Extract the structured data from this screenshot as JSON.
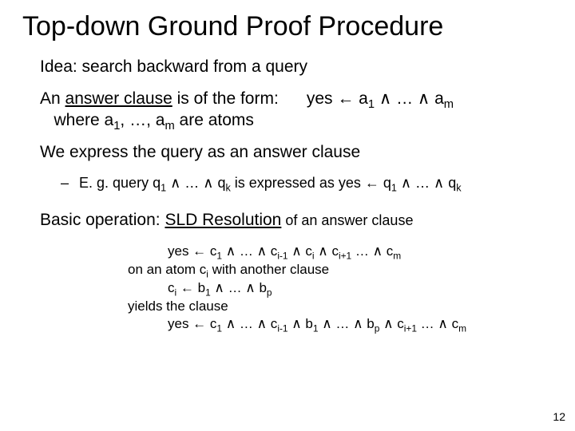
{
  "title": "Top-down Ground Proof Procedure",
  "p_idea": "Idea: search backward from a query",
  "p_answer_clause_1a": "An ",
  "p_answer_clause_1b_u": "answer clause",
  "p_answer_clause_1c": " is of the form:",
  "p_answer_formula": "yes ← a",
  "p_answer_formula_sub1": "1",
  "p_answer_formula_mid": " ∧ … ∧ a",
  "p_answer_formula_subm": "m",
  "p_answer_clause_2a": "where a",
  "p_answer_clause_2b": ", …, a",
  "p_answer_clause_2c": " are atoms",
  "p_express": "We express the query as an answer clause",
  "sub_dash": "–",
  "sub_eg_a": "E. g. query  q",
  "sub_eg_mid": " ∧ … ∧ q",
  "sub_eg_sub_k": "k",
  "sub_eg_b": "  is expressed as   yes ← q",
  "sub_eg_mid2": " ∧ … ∧ q",
  "p_basic_a": "Basic operation: ",
  "p_basic_u": "SLD Resolution",
  "p_basic_b": " of an answer clause",
  "sld_r1a": "yes ← c",
  "sld_r1_mid": " ∧ … ∧ c",
  "sld_r1_im1": "i-1",
  "sld_r1_and_ci": " ∧ c",
  "sld_r1_i": "i",
  "sld_r1_and_cip1": " ∧ c",
  "sld_r1_ip1": "i+1",
  "sld_r1_tail": " … ∧ c",
  "sld_r1_m": "m",
  "sld_r2a": "on an atom c",
  "sld_r2b": " with another clause",
  "sld_r3a": "c",
  "sld_r3b": " ← b",
  "sld_r3_mid": " ∧ … ∧ b",
  "sld_r3_p": "p",
  "sld_r4": "yields the clause",
  "sld_r5a": "yes ← c",
  "sld_r5_mid1": " ∧ … ∧ c",
  "sld_r5_and_b1": " ∧ b",
  "sld_r5_mid2": " ∧ … ∧ b",
  "sld_r5_and_cip1": " ∧ c",
  "sld_r5_tail": " … ∧ c",
  "sub1": "1",
  "page_num": "12"
}
